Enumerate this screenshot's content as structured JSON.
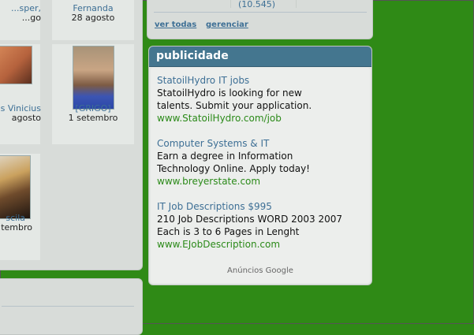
{
  "friends": [
    {
      "name": "...sper,",
      "date": "...go"
    },
    {
      "name": "Fernanda",
      "date": "28 agosto"
    },
    {
      "name": "s Vinicius",
      "date": "agosto"
    },
    {
      "name": "[GRIGO]",
      "date": "1 setembro"
    },
    {
      "name": "scila",
      "date": "tembro"
    }
  ],
  "community": {
    "count": "(10.545)",
    "view_all": "ver todas",
    "manage": "gerenciar"
  },
  "ads": {
    "heading": "publicidade",
    "items": [
      {
        "title": "StatoilHydro IT jobs",
        "line1": "StatoilHydro is looking for new",
        "line2": "talents. Submit your application.",
        "url": "www.StatoilHydro.com/job"
      },
      {
        "title": "Computer Systems & IT",
        "line1": "Earn a degree in Information",
        "line2": "Technology Online. Apply today!",
        "url": "www.breyerstate.com"
      },
      {
        "title": "IT Job Descriptions $995",
        "line1": "210 Job Descriptions WORD 2003 2007",
        "line2": "Each is 3 to 6 Pages in Lenght",
        "url": "www.EJobDescription.com"
      }
    ],
    "footer": "Anúncios Google"
  }
}
